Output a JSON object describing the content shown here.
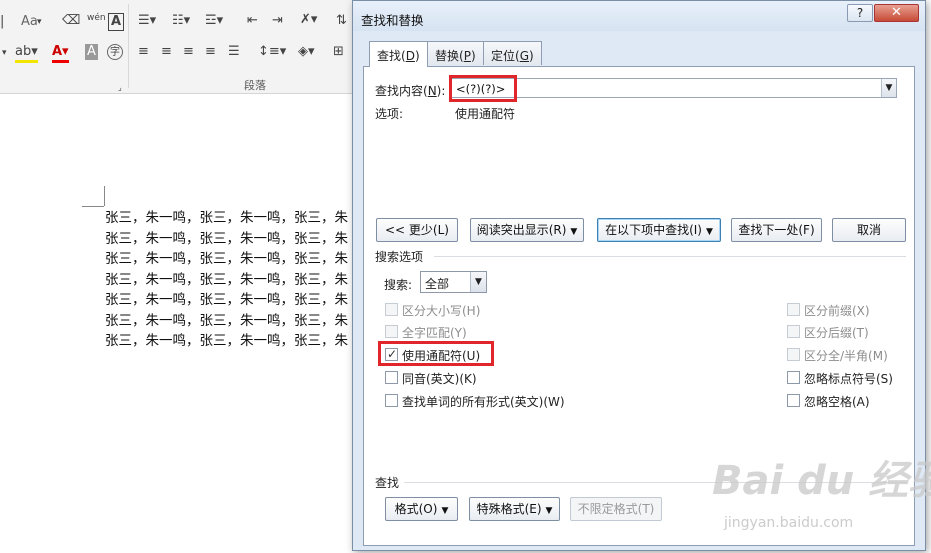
{
  "ribbon": {
    "font_group_icons": [
      "Aa",
      "wén",
      "A"
    ],
    "paragraph_label": "段落"
  },
  "document": {
    "lines": [
      "张三，朱一鸣，张三，朱一鸣，张三，朱",
      "张三，朱一鸣，张三，朱一鸣，张三，朱",
      "张三，朱一鸣，张三，朱一鸣，张三，朱",
      "张三，朱一鸣，张三，朱一鸣，张三，朱",
      "张三，朱一鸣，张三，朱一鸣，张三，朱",
      "张三，朱一鸣，张三，朱一鸣，张三，朱",
      "张三，朱一鸣，张三，朱一鸣，张三，朱"
    ]
  },
  "dialog": {
    "title": "查找和替换",
    "help": "?",
    "close": "✕",
    "tabs": [
      {
        "label": "查找(",
        "key": "D",
        "suffix": ")"
      },
      {
        "label": "替换(",
        "key": "P",
        "suffix": ")"
      },
      {
        "label": "定位(",
        "key": "G",
        "suffix": ")"
      }
    ],
    "find_label": "查找内容(",
    "find_key": "N",
    "find_suffix": "):",
    "find_value": "<(?)(?)>",
    "options_label": "选项:",
    "options_value": "使用通配符",
    "buttons": {
      "less": "<< 更少(L)",
      "reading_highlight": "阅读突出显示(R)",
      "find_in": "在以下项中查找(I)",
      "find_next": "查找下一处(F)",
      "cancel": "取消"
    },
    "search_options_label": "搜索选项",
    "search_label": "搜索:",
    "search_value": "全部",
    "checkboxes_left": [
      {
        "label": "区分大小写(H)",
        "checked": false,
        "enabled": false
      },
      {
        "label": "全字匹配(Y)",
        "checked": false,
        "enabled": false
      },
      {
        "label": "使用通配符(U)",
        "checked": true,
        "enabled": true
      },
      {
        "label": "同音(英文)(K)",
        "checked": false,
        "enabled": true
      },
      {
        "label": "查找单词的所有形式(英文)(W)",
        "checked": false,
        "enabled": true
      }
    ],
    "checkboxes_right": [
      {
        "label": "区分前缀(X)",
        "checked": false,
        "enabled": false
      },
      {
        "label": "区分后缀(T)",
        "checked": false,
        "enabled": false
      },
      {
        "label": "区分全/半角(M)",
        "checked": false,
        "enabled": false
      },
      {
        "label": "忽略标点符号(S)",
        "checked": false,
        "enabled": true
      },
      {
        "label": "忽略空格(A)",
        "checked": false,
        "enabled": true
      }
    ],
    "find_section_label": "查找",
    "bottom_buttons": {
      "format": "格式(O)",
      "special": "特殊格式(E)",
      "no_format": "不限定格式(T)"
    }
  },
  "watermark": {
    "brand": "Bai du 经验",
    "url": "jingyan.baidu.com"
  },
  "colors": {
    "highlight_box": "#e0262a",
    "dialog_bg": "#dfe9f5"
  }
}
